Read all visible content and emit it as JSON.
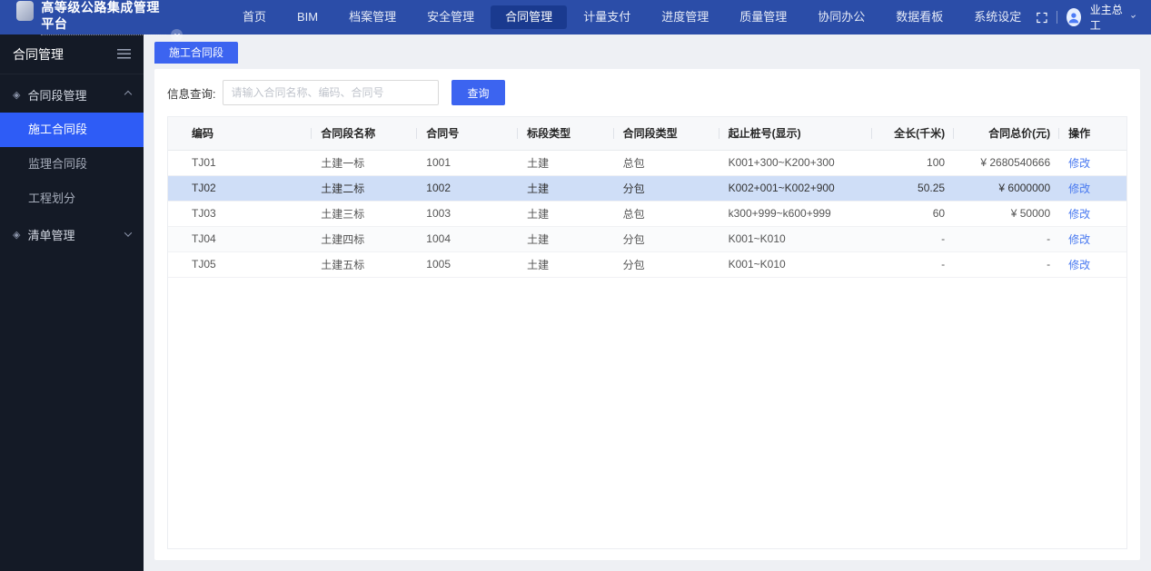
{
  "app": {
    "title": "高等级公路集成管理平台",
    "user": {
      "name": "业主总工"
    }
  },
  "icons": {
    "group_bullet": "◈"
  },
  "topnav": {
    "items": [
      {
        "label": "首页",
        "active": false
      },
      {
        "label": "BIM",
        "active": false
      },
      {
        "label": "档案管理",
        "active": false
      },
      {
        "label": "安全管理",
        "active": false
      },
      {
        "label": "合同管理",
        "active": true
      },
      {
        "label": "计量支付",
        "active": false
      },
      {
        "label": "进度管理",
        "active": false
      },
      {
        "label": "质量管理",
        "active": false
      },
      {
        "label": "协同办公",
        "active": false
      },
      {
        "label": "数据看板",
        "active": false
      },
      {
        "label": "系统设定",
        "active": false
      }
    ]
  },
  "sidebar": {
    "title": "合同管理",
    "groups": [
      {
        "label": "合同段管理",
        "expanded": true,
        "items": [
          {
            "label": "施工合同段",
            "active": true
          },
          {
            "label": "监理合同段",
            "active": false
          },
          {
            "label": "工程划分",
            "active": false
          }
        ]
      },
      {
        "label": "清单管理",
        "expanded": false,
        "items": []
      }
    ]
  },
  "tabs": [
    {
      "label": "施工合同段",
      "active": true
    }
  ],
  "search": {
    "label": "信息查询:",
    "placeholder": "请输入合同名称、编码、合同号",
    "button_label": "查询"
  },
  "table": {
    "columns": [
      {
        "label": "编码",
        "align": "left"
      },
      {
        "label": "合同段名称",
        "align": "left"
      },
      {
        "label": "合同号",
        "align": "left"
      },
      {
        "label": "标段类型",
        "align": "left"
      },
      {
        "label": "合同段类型",
        "align": "left"
      },
      {
        "label": "起止桩号(显示)",
        "align": "left"
      },
      {
        "label": "全长(千米)",
        "align": "right"
      },
      {
        "label": "合同总价(元)",
        "align": "right"
      },
      {
        "label": "操作",
        "align": "left"
      }
    ],
    "action_label": "修改",
    "rows": [
      {
        "selected": false,
        "cells": [
          "TJ01",
          "土建一标",
          "1001",
          "土建",
          "总包",
          "K001+300~K200+300",
          "100",
          "¥ 2680540666"
        ]
      },
      {
        "selected": true,
        "cells": [
          "TJ02",
          "土建二标",
          "1002",
          "土建",
          "分包",
          "K002+001~K002+900",
          "50.25",
          "¥ 6000000"
        ]
      },
      {
        "selected": false,
        "cells": [
          "TJ03",
          "土建三标",
          "1003",
          "土建",
          "总包",
          "k300+999~k600+999",
          "60",
          "¥ 50000"
        ]
      },
      {
        "selected": false,
        "cells": [
          "TJ04",
          "土建四标",
          "1004",
          "土建",
          "分包",
          "K001~K010",
          "-",
          "-"
        ]
      },
      {
        "selected": false,
        "cells": [
          "TJ05",
          "土建五标",
          "1005",
          "土建",
          "分包",
          "K001~K010",
          "-",
          "-"
        ]
      }
    ]
  }
}
